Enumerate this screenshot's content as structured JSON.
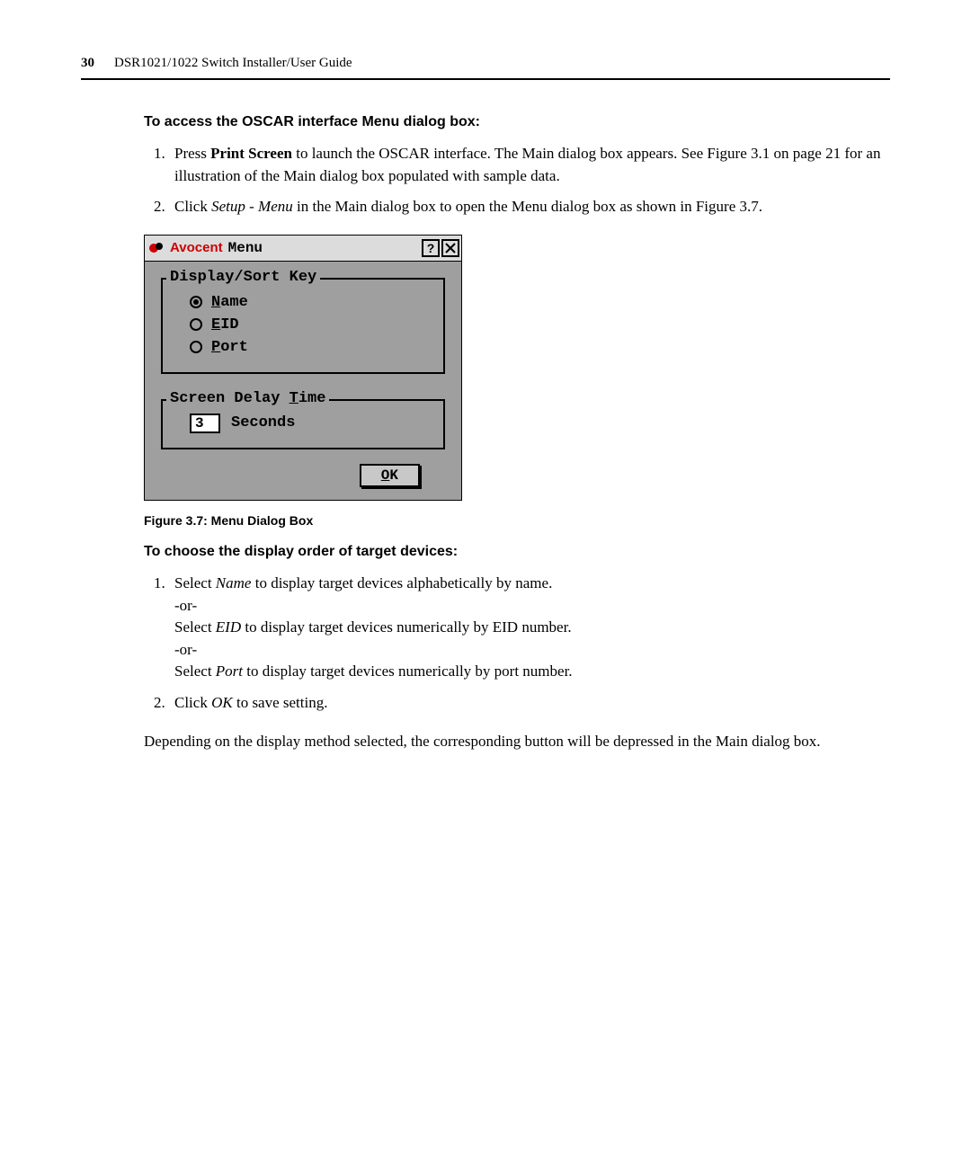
{
  "header": {
    "page_number": "30",
    "doc_title": "DSR1021/1022 Switch Installer/User Guide"
  },
  "section1": {
    "heading": "To access the OSCAR interface Menu dialog box:",
    "step1_pre": "Press ",
    "step1_bold": "Print Screen",
    "step1_post": " to launch the OSCAR interface. The Main dialog box appears. See Figure 3.1 on page 21 for an illustration of the Main dialog box populated with sample data.",
    "step2_pre": "Click ",
    "step2_em1": "Setup",
    "step2_mid": " - ",
    "step2_em2": "Menu",
    "step2_post": " in the Main dialog box to open the Menu dialog box as shown in Figure 3.7."
  },
  "dialog": {
    "brand": "Avocent",
    "title": "Menu",
    "help_label": "?",
    "group1_legend": "Display/Sort Key",
    "radio_name_pre": "N",
    "radio_name_rest": "ame",
    "radio_eid_pre": "E",
    "radio_eid_rest": "ID",
    "radio_port_pre": "P",
    "radio_port_rest": "ort",
    "group2_pre": "Screen Delay ",
    "group2_u": "T",
    "group2_post": "ime",
    "delay_value": "3",
    "delay_unit": "Seconds",
    "ok_u": "O",
    "ok_rest": "K"
  },
  "figure_caption": "Figure 3.7: Menu Dialog Box",
  "section2": {
    "heading": "To choose the display order of target devices:",
    "s1a": "Select ",
    "s1a_em": "Name",
    "s1a_post": " to display target devices alphabetically by name.",
    "or": "-or-",
    "s1b": "Select ",
    "s1b_em": "EID",
    "s1b_post": " to display target devices numerically by EID number.",
    "s1c": "Select ",
    "s1c_em": "Port",
    "s1c_post": " to display target devices numerically by port number.",
    "s2a": "Click ",
    "s2a_em": "OK",
    "s2a_post": " to save setting."
  },
  "closing_para": "Depending on the display method selected, the corresponding button will be depressed in the Main dialog box."
}
